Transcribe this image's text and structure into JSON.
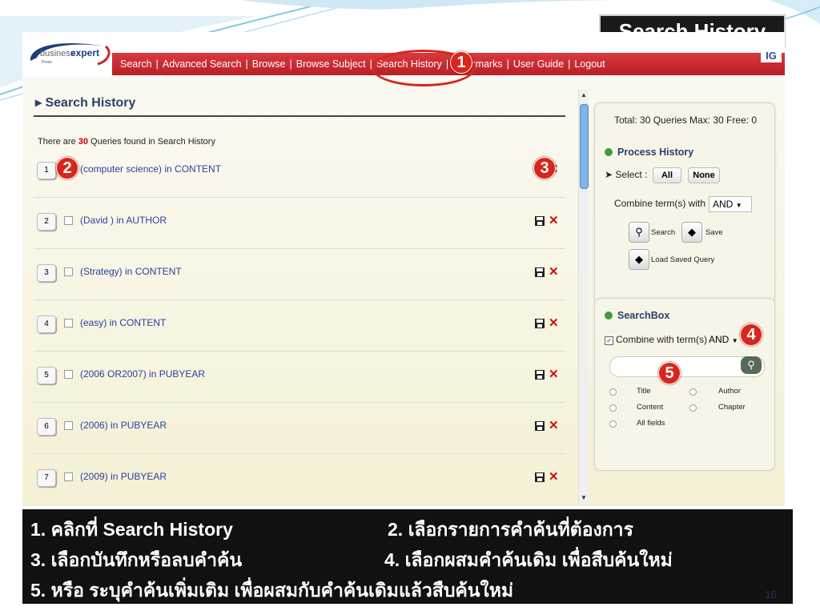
{
  "slide": {
    "title": "Search History",
    "page_number": "16"
  },
  "app": {
    "logo_text_1": "business",
    "logo_text_2": "expert",
    "logo_sub": "Press",
    "nav": [
      "Search",
      "Advanced Search",
      "Browse",
      "Browse Subject",
      "Search History",
      "Bookmarks",
      "User Guide",
      "Logout"
    ],
    "nav_separator": "|",
    "corner_badge": "IG"
  },
  "history": {
    "title": "Search History",
    "found_prefix": "There are ",
    "found_count": "30",
    "found_suffix": " Queries found in Search History",
    "rows": [
      {
        "num": "1",
        "query": "(computer science) in CONTENT"
      },
      {
        "num": "2",
        "query": "(David ) in AUTHOR"
      },
      {
        "num": "3",
        "query": "(Strategy) in CONTENT"
      },
      {
        "num": "4",
        "query": "(easy) in CONTENT"
      },
      {
        "num": "5",
        "query": "(2006 OR2007) in PUBYEAR"
      },
      {
        "num": "6",
        "query": "(2006) in PUBYEAR"
      },
      {
        "num": "7",
        "query": "(2009) in PUBYEAR"
      }
    ],
    "delete_glyph": "✕"
  },
  "process_panel": {
    "totals": "Total: 30 Queries Max: 30 Free: 0",
    "heading": "Process History",
    "select_label": "Select :",
    "all_label": "All",
    "none_label": "None",
    "combine_label": "Combine term(s) with",
    "combine_value": "AND",
    "search_label": "Search",
    "save_label": "Save",
    "load_label": "Load Saved Query"
  },
  "searchbox_panel": {
    "heading": "SearchBox",
    "combine_label": "Combine with term(s)",
    "combine_value": "AND",
    "search_placeholder": "",
    "fields": [
      "Title",
      "Author",
      "Content",
      "Chapter",
      "All fields"
    ]
  },
  "markers": [
    "1",
    "2",
    "3",
    "4",
    "5"
  ],
  "captions": {
    "c1": "1. คลิกที่ Search History",
    "c2": "2. เลือกรายการคำค้นที่ต้องการ",
    "c3": "3. เลือกบันทึกหรือลบคำค้น",
    "c4": "4. เลือกผสมคำค้นเดิม เพื่อสืบค้นใหม่",
    "c5": "5. หรือ ระบุคำค้นเพิ่มเติม เพื่อผสมกับคำค้นเดิมแล้วสืบค้นใหม่"
  },
  "colors": {
    "navbar": "#c8282e",
    "accent_red": "#d8261b",
    "link_blue": "#2a3fa0",
    "caption_bg": "#111111",
    "page_number": "#23365a"
  }
}
